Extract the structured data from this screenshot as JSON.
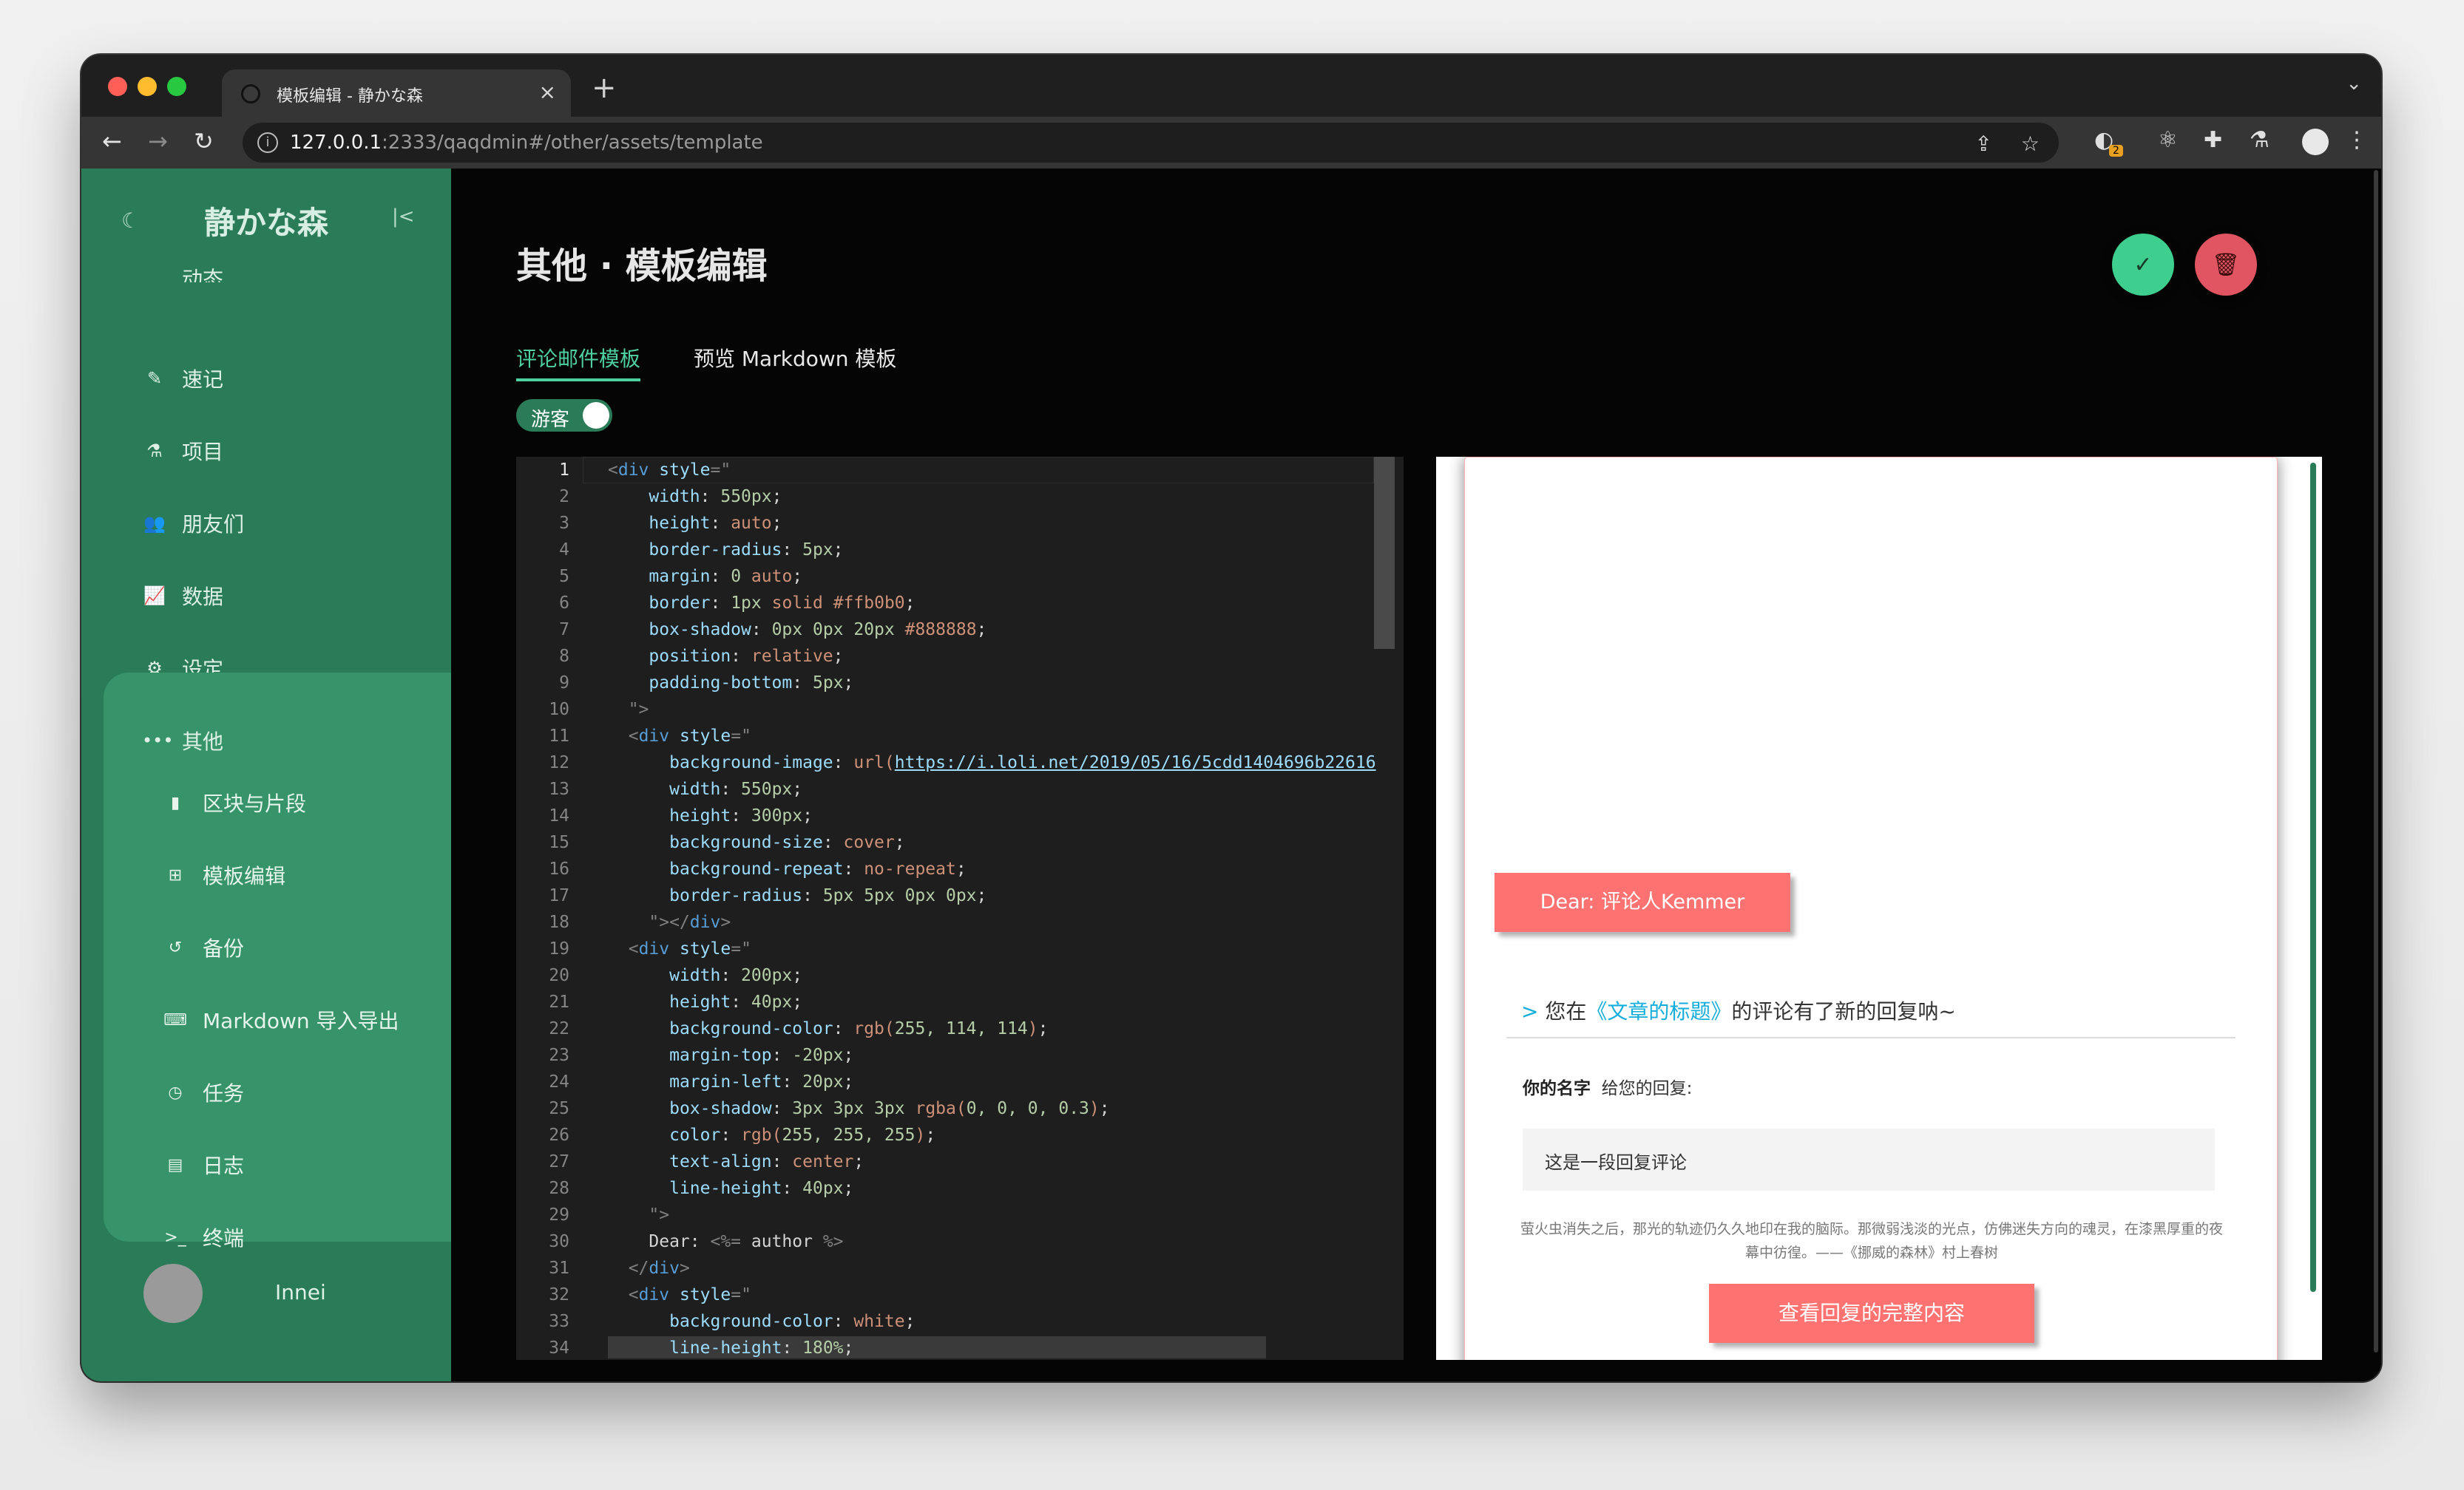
{
  "browser": {
    "tab_title": "模板编辑 - 静かな森",
    "url_host": "127.0.0.1",
    "url_rest": ":2333/qaqdmin#/other/assets/template",
    "extension_badge": "2",
    "traffic_colors": [
      "#ff5f57",
      "#febc2e",
      "#28c840"
    ]
  },
  "sidebar": {
    "brand": "静かな森",
    "partial_item": "动态",
    "items": [
      {
        "label": "速记",
        "icon": "pencil-icon"
      },
      {
        "label": "项目",
        "icon": "flask-icon"
      },
      {
        "label": "朋友们",
        "icon": "users-icon"
      },
      {
        "label": "数据",
        "icon": "chart-icon"
      },
      {
        "label": "设定",
        "icon": "gears-icon"
      }
    ],
    "group": {
      "label": "其他",
      "icon": "ellipsis-icon",
      "items": [
        {
          "label": "区块与片段",
          "icon": "file-icon"
        },
        {
          "label": "模板编辑",
          "icon": "grid-icon"
        },
        {
          "label": "备份",
          "icon": "undo-icon"
        },
        {
          "label": "Markdown 导入导出",
          "icon": "keyboard-icon"
        },
        {
          "label": "任务",
          "icon": "clock-icon"
        },
        {
          "label": "日志",
          "icon": "log-icon"
        },
        {
          "label": "终端",
          "icon": "terminal-icon"
        }
      ]
    },
    "user": {
      "name": "Innei"
    }
  },
  "main": {
    "title": "其他 · 模板编辑",
    "tabs": [
      {
        "label": "评论邮件模板",
        "active": true
      },
      {
        "label": "预览 Markdown 模板",
        "active": false
      }
    ],
    "switch_label": "游客",
    "accent": "#4fd0a0",
    "save_color": "#3ecf8e",
    "delete_color": "#e05561"
  },
  "editor": {
    "line_count": 34,
    "current_line": 1
  },
  "preview": {
    "dear": "Dear: 评论人Kemmer",
    "reply_prefix": ">",
    "reply_before": "您在",
    "reply_link": "《文章的标题》",
    "reply_after": "的评论有了新的回复呐~",
    "your_name": "你的名字",
    "reply_to_you": "给您的回复:",
    "reply_content": "这是一段回复评论",
    "quote_1": "萤火虫消失之后，那光的轨迹仍久久地印在我的脑际。那微弱浅淡的光点，仿佛迷失方向的魂灵，在漆黑厚重的夜",
    "quote_2": "幕中彷徨。——《挪威的森林》村上春树",
    "view_button": "查看回复的完整内容",
    "button_color": "rgb(255, 114, 114)"
  }
}
